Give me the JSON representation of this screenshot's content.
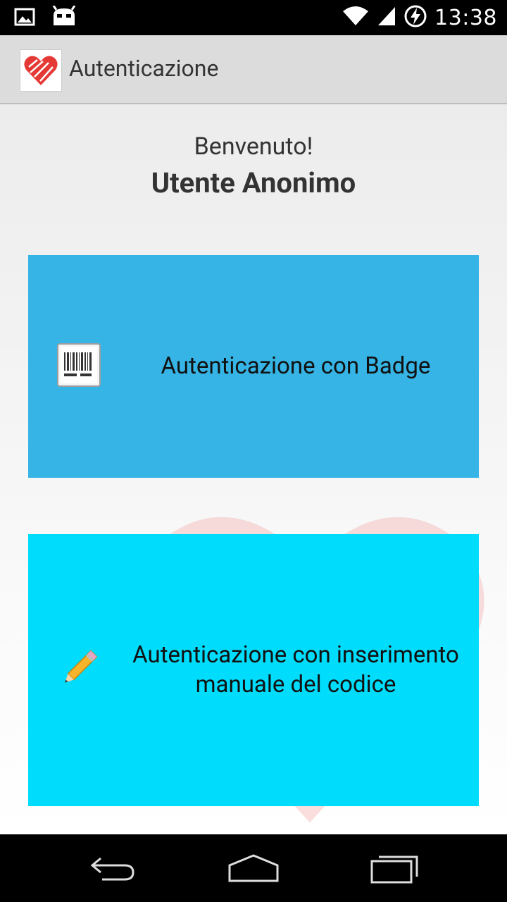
{
  "status_bar": {
    "time": "13:38",
    "icons": [
      "gallery-notification-icon",
      "android-notification-icon",
      "wifi-icon",
      "signal-icon",
      "battery-charging-icon"
    ]
  },
  "action_bar": {
    "title": "Autenticazione",
    "app_icon": "heart-logo-icon"
  },
  "main": {
    "welcome": "Benvenuto!",
    "username": "Utente Anonimo",
    "buttons": [
      {
        "label": "Autenticazione con Badge",
        "icon": "barcode-icon",
        "color": "#35b4e5"
      },
      {
        "label": "Autenticazione con inserimento manuale del codice",
        "icon": "pencil-icon",
        "color": "#00dcfc"
      }
    ]
  },
  "nav_bar": {
    "buttons": [
      "back-icon",
      "home-icon",
      "recents-icon"
    ]
  }
}
